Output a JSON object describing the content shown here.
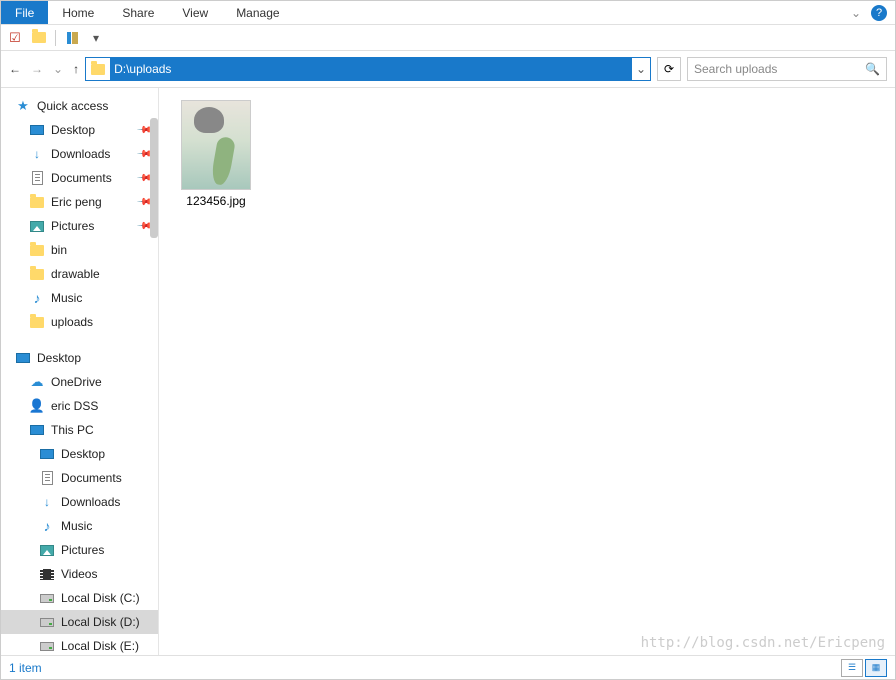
{
  "ribbon": {
    "file": "File",
    "home": "Home",
    "share": "Share",
    "view": "View",
    "manage": "Manage"
  },
  "addressbar": {
    "path": "D:\\uploads"
  },
  "search": {
    "placeholder": "Search uploads"
  },
  "sidebar": {
    "quick_access": "Quick access",
    "quick_items": [
      {
        "label": "Desktop",
        "pinned": true,
        "icon": "monitor"
      },
      {
        "label": "Downloads",
        "pinned": true,
        "icon": "download"
      },
      {
        "label": "Documents",
        "pinned": true,
        "icon": "doc"
      },
      {
        "label": "Eric peng",
        "pinned": true,
        "icon": "folder"
      },
      {
        "label": "Pictures",
        "pinned": true,
        "icon": "pic"
      },
      {
        "label": "bin",
        "pinned": false,
        "icon": "folder"
      },
      {
        "label": "drawable",
        "pinned": false,
        "icon": "folder"
      },
      {
        "label": "Music",
        "pinned": false,
        "icon": "music"
      },
      {
        "label": "uploads",
        "pinned": false,
        "icon": "folder"
      }
    ],
    "desktop": "Desktop",
    "onedrive": "OneDrive",
    "user": "eric DSS",
    "thispc": "This PC",
    "pc_items": [
      {
        "label": "Desktop",
        "icon": "monitor"
      },
      {
        "label": "Documents",
        "icon": "doc"
      },
      {
        "label": "Downloads",
        "icon": "download"
      },
      {
        "label": "Music",
        "icon": "music"
      },
      {
        "label": "Pictures",
        "icon": "pic"
      },
      {
        "label": "Videos",
        "icon": "video"
      },
      {
        "label": "Local Disk (C:)",
        "icon": "disk"
      },
      {
        "label": "Local Disk (D:)",
        "icon": "disk",
        "selected": true
      },
      {
        "label": "Local Disk (E:)",
        "icon": "disk"
      }
    ]
  },
  "files": [
    {
      "name": "123456.jpg"
    }
  ],
  "statusbar": {
    "count": "1 item"
  },
  "watermark": "http://blog.csdn.net/Ericpeng"
}
